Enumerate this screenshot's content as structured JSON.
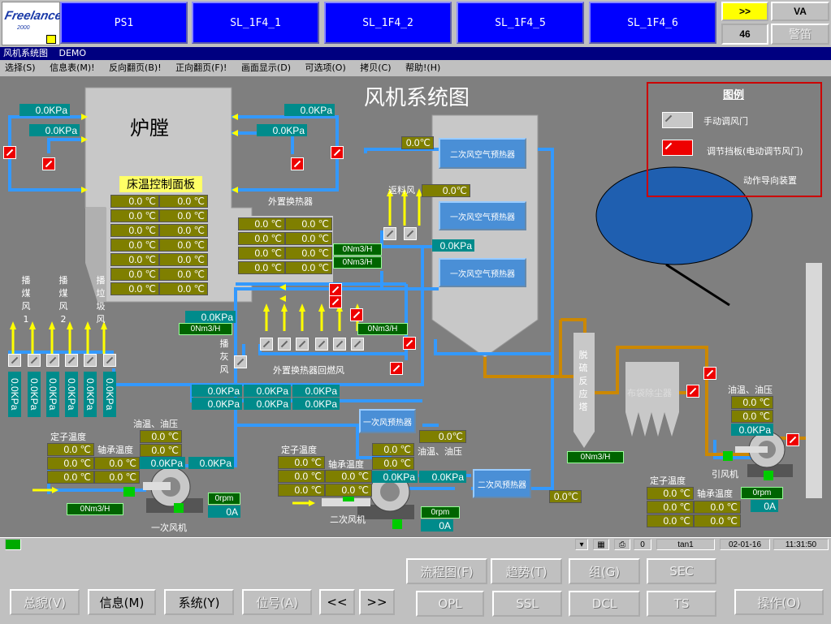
{
  "topbar": {
    "logo": {
      "main": "Freelance",
      "sub": "2000"
    },
    "tags": [
      "PS1",
      "SL_1F4_1",
      "SL_1F4_2",
      "SL_1F4_5",
      "SL_1F4_6"
    ],
    "nav_next": ">>",
    "count": "46",
    "va": "VA",
    "alarm": "警笛"
  },
  "titlebar": {
    "title": "风机系统图",
    "mode": "DEMO"
  },
  "menu": [
    "选择(S)",
    "信息表(M)!",
    "反向翻页(B)!",
    "正向翻页(F)!",
    "画面显示(D)",
    "可选项(O)",
    "拷贝(C)",
    "帮助!(H)"
  ],
  "display": {
    "title": "风机系统图",
    "furnace": "炉膛",
    "bed_temp_panel": "床温控制面板",
    "ext_hx": "外置换热器",
    "ext_hx_return": "外置换热器回燃风",
    "return_air": "返料风",
    "desulf": "脱硫反应塔",
    "bag_filter": "布袋除尘器",
    "idfan": "引风机",
    "pfan": "一次风机",
    "sfan": "二次风机",
    "oil_label": "油温、油压",
    "stator_label": "定子温度",
    "bearing_label": "轴承温度",
    "seed_coal_1": "播煤风1",
    "seed_coal_2": "播煤风2",
    "seed_lime": "播垃圾风",
    "seed_ash": "播灰风",
    "heater2": "二次风空气预热器",
    "heater1a": "一次风空气预热器",
    "heater1b": "一次风空气预热器",
    "heater1c": "一次风预热器",
    "heater2b": "二次风预热器",
    "legend": {
      "title": "图例",
      "items": [
        "手动调风门",
        "调节挡板(电动调节风门)",
        "动作导向装置"
      ]
    },
    "kpa0": "0.0KPa",
    "deg0": "0.0 ℃",
    "deg0b": "0.0℃",
    "flow0": "0Nm3/H",
    "rpm0": "0rpm",
    "amp0": "0A"
  },
  "status": {
    "n": "0",
    "user": "tan1",
    "date": "02-01-16",
    "time": "11:31:50"
  },
  "buttons": {
    "row1": [
      "流程图(F)",
      "趋势(T)",
      "组(G)",
      "SEC"
    ],
    "row2": [
      "OPL",
      "SSL",
      "DCL",
      "TS"
    ],
    "left": [
      "总貌(V)",
      "信息(M)",
      "系统(Y)",
      "位号(A)",
      "<<",
      ">>"
    ],
    "op": "操作(O)"
  },
  "colors": {
    "pipe": "#3399ff",
    "duct": "#cc8800",
    "bg": "#7f7f7f",
    "readout": "#008b8b",
    "olive": "#7f7f00"
  }
}
